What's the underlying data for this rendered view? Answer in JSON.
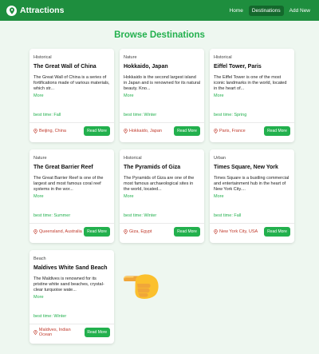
{
  "nav": {
    "brand": "Attractions",
    "links": [
      {
        "label": "Home"
      },
      {
        "label": "Destinations"
      },
      {
        "label": "Add New"
      }
    ]
  },
  "page": {
    "title": "Browse Destinations"
  },
  "cards": [
    {
      "category": "Historical",
      "title": "The Great Wall of China",
      "description": "The Great Wall of China is a series of fortifications made of various materials, which str...",
      "more": "More",
      "best_time": "best time: Fall",
      "location": "Beijing, China",
      "button": "Read More"
    },
    {
      "category": "Nature",
      "title": "Hokkaido, Japan",
      "description": "Hokkaido is the second largest island in Japan and is renowned for its natural beauty. Kno...",
      "more": "More",
      "best_time": "best time: Winter",
      "location": "Hokkaido, Japan",
      "button": "Read More"
    },
    {
      "category": "Historical",
      "title": "Eiffel Tower, Paris",
      "description": "The Eiffel Tower is one of the most iconic landmarks in the world, located in the heart of...",
      "more": "More",
      "best_time": "best time: Spring",
      "location": "Paris, France",
      "button": "Read More"
    },
    {
      "category": "Nature",
      "title": "The Great Barrier Reef",
      "description": "The Great Barrier Reef is one of the largest and most famous coral reef systems in the wor...",
      "more": "More",
      "best_time": "best time: Summer",
      "location": "Queensland, Australia",
      "button": "Read More"
    },
    {
      "category": "Historical",
      "title": "The Pyramids of Giza",
      "description": "The Pyramids of Giza are one of the most famous archaeological sites in the world, located...",
      "more": "More",
      "best_time": "best time: Winter",
      "location": "Giza, Egypt",
      "button": "Read More"
    },
    {
      "category": "Urban",
      "title": "Times Square, New York",
      "description": "Times Square is a bustling commercial and entertainment hub in the heart of New York City....",
      "more": "More",
      "best_time": "best time: Fall",
      "location": "New York City, USA",
      "button": "Read More"
    },
    {
      "category": "Beach",
      "title": "Maldives White Sand Beach",
      "description": "The Maldives is renowned for its pristine white sand beaches, crystal-clear turquoise wate...",
      "more": "More",
      "best_time": "best time: Winter",
      "location": "Maldives, Indian Ocean",
      "button": "Read More"
    }
  ],
  "icons": {
    "brand": "map-pin-icon",
    "location": "map-pin-icon",
    "pointer": "pointing-hand-icon"
  },
  "colors": {
    "nav": "#1e8e3e",
    "accent": "#22b04d",
    "location": "#c0392b",
    "background": "#eef7f0"
  }
}
